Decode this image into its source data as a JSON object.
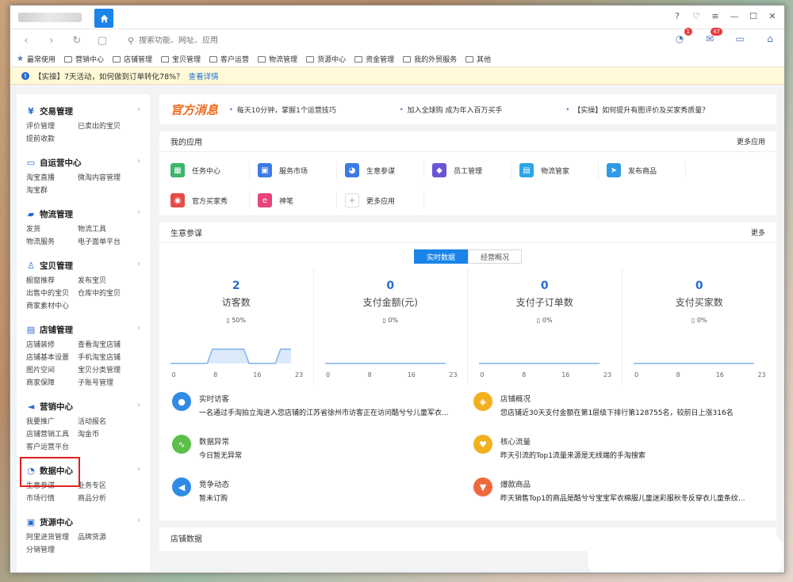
{
  "browser": {
    "nav_search_placeholder": "搜索功能、网址、应用",
    "badges": {
      "alerts": "1",
      "mail": "47"
    }
  },
  "bookmarks": [
    "最常使用",
    "营销中心",
    "店铺管理",
    "宝贝管理",
    "客户运营",
    "物流管理",
    "货源中心",
    "资金管理",
    "我的外贸服务",
    "其他"
  ],
  "notice": {
    "text": "【实操】7天活动，如何做到订单转化78%？",
    "link": "查看详情"
  },
  "sidebar": {
    "sections": [
      {
        "title": "交易管理",
        "icon": "yen-icon",
        "links": [
          "评价管理",
          "已卖出的宝贝",
          "提前收款"
        ]
      },
      {
        "title": "自运营中心",
        "icon": "chat-icon",
        "links": [
          "淘宝直播",
          "微淘内容管理",
          "淘宝群"
        ]
      },
      {
        "title": "物流管理",
        "icon": "truck-icon",
        "links": [
          "发货",
          "物流工具",
          "物流服务",
          "电子面单平台"
        ]
      },
      {
        "title": "宝贝管理",
        "icon": "shirt-icon",
        "links": [
          "橱窗推荐",
          "发布宝贝",
          "出售中的宝贝",
          "仓库中的宝贝",
          "商家素材中心"
        ]
      },
      {
        "title": "店铺管理",
        "icon": "store-icon",
        "links": [
          "店铺装修",
          "查看淘宝店铺",
          "店铺基本设置",
          "手机淘宝店铺",
          "图片空间",
          "宝贝分类管理",
          "商家保障",
          "子账号管理"
        ]
      },
      {
        "title": "营销中心",
        "icon": "megaphone-icon",
        "links": [
          "我要推广",
          "活动报名",
          "店铺营销工具",
          "淘金币",
          "客户运营平台"
        ]
      },
      {
        "title": "数据中心",
        "icon": "compass-icon",
        "links": [
          "生意参谋",
          "业务专区",
          "市场行情",
          "商品分析"
        ]
      },
      {
        "title": "货源中心",
        "icon": "box-icon",
        "links": [
          "阿里进货管理",
          "品牌货源",
          "分销管理"
        ]
      }
    ]
  },
  "official": {
    "brand": "官方消息",
    "messages": [
      "每天10分钟，掌握1个运营技巧",
      "加入全球购 成为年入百万买手",
      "【实操】如何提升有图评价及买家秀质量？"
    ]
  },
  "apps_card": {
    "title": "我的应用",
    "more": "更多应用",
    "apps": [
      {
        "label": "任务中心",
        "color": "#3bb56b",
        "icon": "calendar-icon",
        "glyph": "▦"
      },
      {
        "label": "服务市场",
        "color": "#3b7ae6",
        "icon": "grid-icon",
        "glyph": "▣"
      },
      {
        "label": "生意参谋",
        "color": "#3b7ae6",
        "icon": "chart-bubble-icon",
        "glyph": "◕"
      },
      {
        "label": "员工管理",
        "color": "#6a55d6",
        "icon": "user-icon",
        "glyph": "◆"
      },
      {
        "label": "物流管家",
        "color": "#2ba6e6",
        "icon": "logistics-icon",
        "glyph": "▤"
      },
      {
        "label": "发布商品",
        "color": "#2f9be6",
        "icon": "send-icon",
        "glyph": "➤"
      },
      {
        "label": "官方买家秀",
        "color": "#e84a4a",
        "icon": "camera-icon",
        "glyph": "◉"
      },
      {
        "label": "神笔",
        "color": "#e8447a",
        "icon": "pen-icon",
        "glyph": "e"
      },
      {
        "label": "更多应用",
        "color": "#ffffff",
        "icon": "plus-icon",
        "glyph": "+"
      }
    ]
  },
  "business": {
    "title": "生意参谋",
    "more": "更多",
    "tabs": [
      "实时数据",
      "经营概况"
    ],
    "stats": [
      {
        "value": "2",
        "label": "访客数",
        "pct": "50%"
      },
      {
        "value": "0",
        "label": "支付金额(元)",
        "pct": "0%"
      },
      {
        "value": "0",
        "label": "支付子订单数",
        "pct": "0%"
      },
      {
        "value": "0",
        "label": "支付买家数",
        "pct": "0%"
      }
    ],
    "axis_ticks": [
      "0",
      "8",
      "16",
      "23"
    ],
    "feed": [
      {
        "title": "实时访客",
        "desc": "一名通过手淘拍立淘进入您店铺的江苏省徐州市访客正在访问酷兮兮儿童军衣...",
        "color": "#2f8be6",
        "icon": "mic-icon",
        "glyph": "●"
      },
      {
        "title": "店铺概况",
        "desc": "您店铺近30天支付金额在第1层级下排行第128755名，较前日上涨316名",
        "color": "#f2b01e",
        "icon": "tag-icon",
        "glyph": "◈"
      },
      {
        "title": "数据异常",
        "desc": "今日暂无异常",
        "color": "#5cbf4a",
        "icon": "pulse-icon",
        "glyph": "∿"
      },
      {
        "title": "核心流量",
        "desc": "昨天引流的Top1流量来源是无线端的手淘搜索",
        "color": "#f2b01e",
        "icon": "heart-icon",
        "glyph": "♥"
      },
      {
        "title": "竞争动态",
        "desc": "暂未订购",
        "color": "#2f8be6",
        "icon": "speaker-icon",
        "glyph": "◀"
      },
      {
        "title": "爆款商品",
        "desc": "昨天销售Top1的商品是酷兮兮宝宝军衣棉服儿童迷彩服秋冬反穿衣儿童条纹...",
        "color": "#ee6a3e",
        "icon": "cart-icon",
        "glyph": "▼"
      }
    ]
  },
  "shop_data": {
    "title": "店铺数据"
  },
  "series": {
    "visitors": [
      0,
      0,
      0,
      0,
      0,
      0,
      0,
      0,
      1,
      1,
      1,
      1,
      1,
      1,
      1,
      0,
      0,
      0,
      0,
      0,
      0,
      1,
      1,
      1
    ],
    "flat": [
      0,
      0,
      0,
      0,
      0,
      0,
      0,
      0,
      0,
      0,
      0,
      0,
      0,
      0,
      0,
      0,
      0,
      0,
      0,
      0,
      0,
      0,
      0,
      0
    ]
  }
}
